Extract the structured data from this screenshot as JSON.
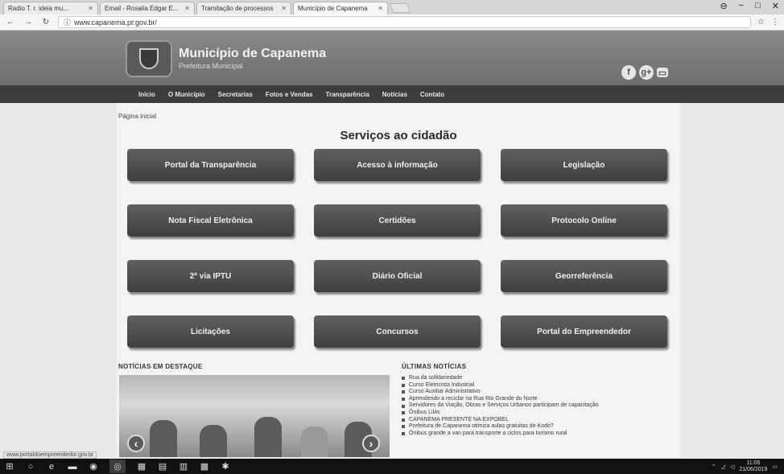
{
  "browser": {
    "tabs": [
      {
        "title": "Radio T. r. ideia mu..."
      },
      {
        "title": "Email - Rosalia Edgar E..."
      },
      {
        "title": "Tramitação de processos"
      },
      {
        "title": "Município de Capanema",
        "active": true
      }
    ],
    "url": "www.capanema.pr.gov.br/",
    "back_icon": "back-arrow-icon",
    "reload_icon": "reload-icon"
  },
  "site": {
    "title": "Município de Capanema",
    "subtitle": "Prefeitura Municipal",
    "nav": [
      "Início",
      "O Município",
      "Secretarias",
      "Fotos e Vendas",
      "Transparência",
      "Notícias",
      "Contato"
    ],
    "social": [
      "f",
      "g+",
      "▭"
    ]
  },
  "breadcrumb": "Página inicial",
  "services": {
    "title": "Serviços ao cidadão",
    "buttons": [
      "Portal da Transparência",
      "Acesso à informação",
      "Legislação",
      "Nota Fiscal Eletrônica",
      "Certidões",
      "Protocolo Online",
      "2ª via IPTU",
      "Diário Oficial",
      "Georreferência",
      "Licitações",
      "Concursos",
      "Portal do Empreendedor"
    ]
  },
  "news": {
    "featured_heading": "NOTÍCIAS EM DESTAQUE",
    "latest_heading": "ÚLTIMAS NOTÍCIAS",
    "latest": [
      "Rua da solidariedade",
      "Curso Eletricista Industrial",
      "Curso Auxiliar Administrativo",
      "Aprendendo a reciclar na Rua Rio Grande do Norte",
      "Servidores da Viação, Obras e Serviços Urbanos participam de capacitação",
      "Ônibus Lilás",
      "CAPANEMA PRESENTE NA EXPOBEL",
      "Prefeitura de Capanema otimiza aulas gratuitas de Kodó?",
      "Ônibus grande a van para transporte a ciclos para turismo rural"
    ]
  },
  "status_url": "www.portaldoempreendedor.gov.br",
  "taskbar": {
    "tray_time": "11:06",
    "tray_date": "21/06/2019"
  }
}
